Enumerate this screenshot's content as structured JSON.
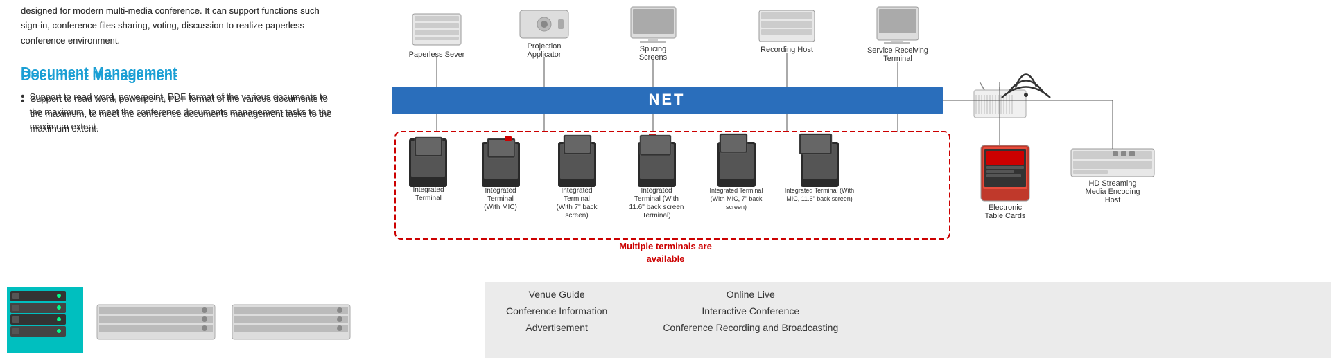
{
  "left": {
    "intro": "designed for modern multi-media conference.\nIt can support functions such sign-in, conference files sharing, voting, discussion to realize paperless conference environment.",
    "doc_title": "Document Management",
    "bullet": "Support to read word, powerpoint, PDF format of the various documents to the maximum, to meet the conference documents management tasks to the maximum extent."
  },
  "net_label": "NET",
  "top_devices": [
    {
      "label": "Paperless Sever",
      "type": "server"
    },
    {
      "label": "Projection\nApplicator",
      "type": "projector"
    },
    {
      "label": "Splicing\nScreens",
      "type": "screen"
    },
    {
      "label": "Recording Host",
      "type": "recorder"
    },
    {
      "label": "Service Receiving\nTerminal",
      "type": "terminal"
    }
  ],
  "terminals": [
    {
      "label": "Integrated\nTerminal",
      "has_back": false,
      "has_mic": false
    },
    {
      "label": "Integrated\nTerminal\n(With MIC)",
      "has_back": false,
      "has_mic": true
    },
    {
      "label": "Integrated\nTerminal\n(With 7\" back\nscreen)",
      "has_back": true,
      "has_mic": false
    },
    {
      "label": "Integrated\nTerminal\n(With\n11.6\" back screen\nTerminal)",
      "has_back": true,
      "has_mic": false
    },
    {
      "label": "Integrated Terminal\n(With MIC, 7\" back\nscreen)",
      "has_back": true,
      "has_mic": true
    },
    {
      "label": "Integrated Terminal (With\nMIC, 11.6\" back screen)",
      "has_back": true,
      "has_mic": true
    }
  ],
  "multiple_text": "Multiple terminals are\navailable",
  "right_devices": [
    {
      "label": "Electronic\nTable Cards",
      "type": "card"
    },
    {
      "label": "HD Streaming\nMedia Encoding\nHost",
      "type": "encoder"
    }
  ],
  "footer": {
    "links_col1": [
      "Venue Guide",
      "Conference Information",
      "Advertisement"
    ],
    "links_col2": [
      "Online Live",
      "Interactive Conference",
      "Conference Recording and Broadcasting"
    ]
  }
}
